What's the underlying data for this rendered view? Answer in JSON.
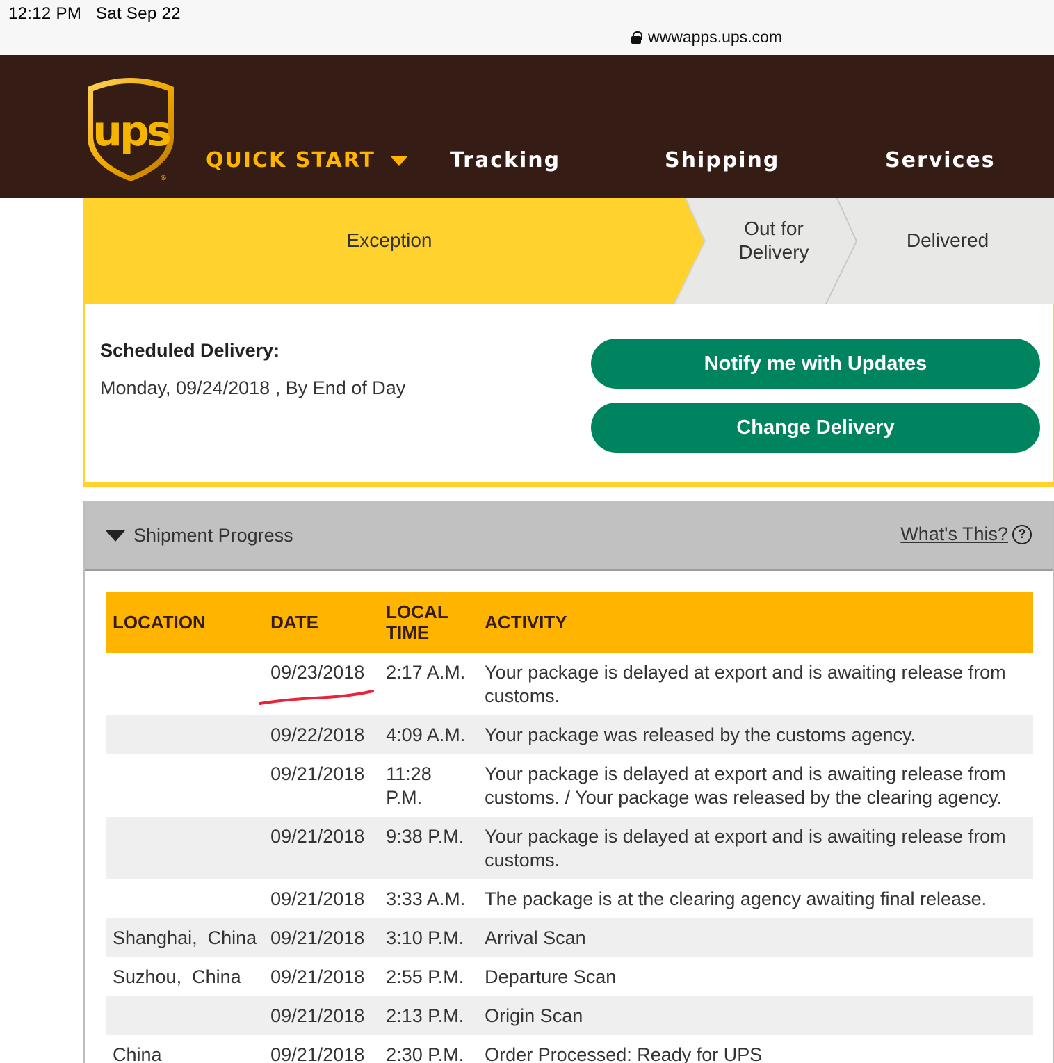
{
  "status_bar": {
    "time_date": "12:12 PM   Sat Sep 22",
    "url": "wwwapps.ups.com"
  },
  "nav": {
    "logo_text": "ups",
    "quick_start": "QUICK START",
    "tracking": "Tracking",
    "shipping": "Shipping",
    "services": "Services"
  },
  "colors": {
    "brown": "#351c15",
    "gold": "#ffb500",
    "yellow": "#ffd22e",
    "green": "#00845f"
  },
  "progress_steps": {
    "current": "Exception",
    "next_line1": "Out for",
    "next_line2": "Delivery",
    "last": "Delivered"
  },
  "delivery": {
    "title": "Scheduled Delivery:",
    "value": "Monday, 09/24/2018 , By End of Day",
    "notify_button": "Notify me with Updates",
    "change_button": "Change Delivery"
  },
  "shipment_progress": {
    "title": "Shipment Progress",
    "whats_this": "What's This?",
    "help_glyph": "?",
    "headers": {
      "location": "LOCATION",
      "date": "DATE",
      "time_line1": "LOCAL",
      "time_line2": "TIME",
      "activity": "ACTIVITY"
    },
    "rows": [
      {
        "location": "",
        "date": "09/23/2018",
        "time": "2:17 A.M.",
        "activity": "Your package is delayed at export and is awaiting release from customs."
      },
      {
        "location": "",
        "date": "09/22/2018",
        "time": "4:09 A.M.",
        "activity": "Your package was released by the customs agency."
      },
      {
        "location": "",
        "date": "09/21/2018",
        "time": "11:28 P.M.",
        "activity": "Your package is delayed at export and is awaiting release from customs. / Your package was released by the clearing agency."
      },
      {
        "location": "",
        "date": "09/21/2018",
        "time": "9:38 P.M.",
        "activity": "Your package is delayed at export and is awaiting release from customs."
      },
      {
        "location": "",
        "date": "09/21/2018",
        "time": "3:33 A.M.",
        "activity": "The package is at the clearing agency awaiting final release."
      },
      {
        "location": "Shanghai,  China",
        "date": "09/21/2018",
        "time": "3:10 P.M.",
        "activity": "Arrival Scan"
      },
      {
        "location": "Suzhou,  China",
        "date": "09/21/2018",
        "time": "2:55 P.M.",
        "activity": "Departure Scan"
      },
      {
        "location": "",
        "date": "09/21/2018",
        "time": "2:13 P.M.",
        "activity": "Origin Scan"
      },
      {
        "location": "China",
        "date": "09/21/2018",
        "time": "2:30 P.M.",
        "activity": "Order Processed: Ready for UPS"
      }
    ]
  }
}
